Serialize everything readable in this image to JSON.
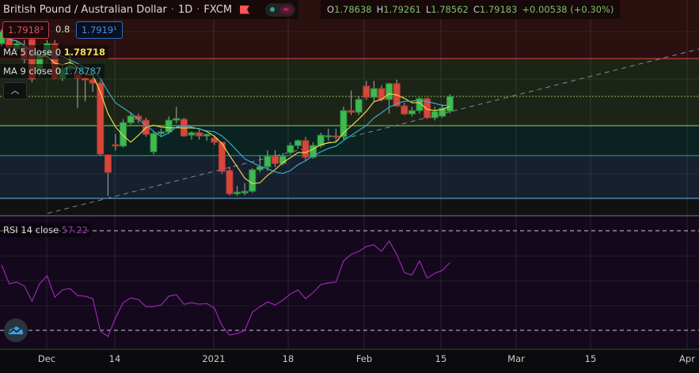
{
  "header": {
    "title": "British Pound / Australian Dollar",
    "interval": "1D",
    "exchange": "FXCM",
    "sep": "·"
  },
  "ohlc": {
    "o_label": "O",
    "o": "1.78638",
    "h_label": "H",
    "h": "1.79261",
    "l_label": "L",
    "l": "1.78562",
    "c_label": "C",
    "c": "1.79183",
    "change": "+0.00538 (+0.30%)"
  },
  "bid_ask": {
    "sell": "1.7918³",
    "spread": "0.8",
    "buy": "1.7919¹"
  },
  "legend": {
    "ma5_label": "MA 5 close 0",
    "ma5_value": "1.78718",
    "ma9_label": "MA 9 close 0",
    "ma9_value": "1.78787",
    "rsi_label": "RSI 14 close",
    "rsi_value": "57.22"
  },
  "collapse_icon": "chevron-up-icon",
  "colors": {
    "up": "#3fb950",
    "down": "#d9463c",
    "ma5": "#e6d84a",
    "ma9": "#39a9c9",
    "rsi": "#9c27b0"
  },
  "chart_data": [
    {
      "type": "candlestick",
      "title": "British Pound / Australian Dollar · 1D · FXCM",
      "x_ticks": [
        "Dec",
        "14",
        "2021",
        "18",
        "Feb",
        "15",
        "Mar",
        "15",
        "Apr"
      ],
      "levels": [
        1.8057,
        1.7811,
        1.7701,
        1.7544
      ],
      "current_price": 1.79183,
      "candles": [
        [
          1.8112,
          1.8165,
          1.81,
          1.8156
        ],
        [
          1.8142,
          1.815,
          1.8085,
          1.8098
        ],
        [
          1.8092,
          1.812,
          1.808,
          1.8112
        ],
        [
          1.8104,
          1.8125,
          1.804,
          1.8054
        ],
        [
          1.8127,
          1.8135,
          1.797,
          1.7982
        ],
        [
          1.8011,
          1.808,
          1.799,
          1.8069
        ],
        [
          1.8069,
          1.8125,
          1.806,
          1.8112
        ],
        [
          1.8112,
          1.8125,
          1.7982,
          1.7985
        ],
        [
          1.7985,
          1.803,
          1.7975,
          1.802
        ],
        [
          1.802,
          1.808,
          1.801,
          1.8031
        ],
        [
          1.7997,
          1.801,
          1.7875,
          1.7985
        ],
        [
          1.7985,
          1.799,
          1.79,
          1.7979
        ],
        [
          1.7979,
          1.799,
          1.7935,
          1.7967
        ],
        [
          1.7967,
          1.7975,
          1.77,
          1.7707
        ],
        [
          1.7704,
          1.7705,
          1.7553,
          1.764
        ],
        [
          1.7741,
          1.778,
          1.772,
          1.7736
        ],
        [
          1.7736,
          1.7835,
          1.773,
          1.7822
        ],
        [
          1.7822,
          1.786,
          1.7815,
          1.7846
        ],
        [
          1.7846,
          1.7855,
          1.782,
          1.7834
        ],
        [
          1.7831,
          1.784,
          1.777,
          1.7779
        ],
        [
          1.7715,
          1.779,
          1.7705,
          1.7782
        ],
        [
          1.7782,
          1.78,
          1.777,
          1.7788
        ],
        [
          1.7788,
          1.7845,
          1.778,
          1.7831
        ],
        [
          1.7831,
          1.788,
          1.782,
          1.7837
        ],
        [
          1.7834,
          1.784,
          1.777,
          1.7773
        ],
        [
          1.7776,
          1.779,
          1.776,
          1.7785
        ],
        [
          1.7785,
          1.7795,
          1.776,
          1.7773
        ],
        [
          1.7773,
          1.7782,
          1.7755,
          1.7779
        ],
        [
          1.7765,
          1.7775,
          1.774,
          1.775
        ],
        [
          1.775,
          1.7752,
          1.7635,
          1.7643
        ],
        [
          1.7646,
          1.766,
          1.7555,
          1.7561
        ],
        [
          1.7561,
          1.759,
          1.7553,
          1.7567
        ],
        [
          1.7564,
          1.76,
          1.7555,
          1.757
        ],
        [
          1.757,
          1.7655,
          1.7565,
          1.7649
        ],
        [
          1.7649,
          1.77,
          1.764,
          1.766
        ],
        [
          1.766,
          1.772,
          1.7645,
          1.7698
        ],
        [
          1.7698,
          1.772,
          1.766,
          1.7672
        ],
        [
          1.7672,
          1.771,
          1.7665,
          1.7698
        ],
        [
          1.7712,
          1.775,
          1.7705,
          1.7738
        ],
        [
          1.7738,
          1.776,
          1.7725,
          1.7756
        ],
        [
          1.7756,
          1.777,
          1.768,
          1.7695
        ],
        [
          1.7695,
          1.775,
          1.769,
          1.7738
        ],
        [
          1.7738,
          1.7785,
          1.773,
          1.7776
        ],
        [
          1.7772,
          1.78,
          1.7755,
          1.7774
        ],
        [
          1.7773,
          1.78,
          1.776,
          1.777
        ],
        [
          1.777,
          1.788,
          1.776,
          1.7866
        ],
        [
          1.7866,
          1.794,
          1.785,
          1.786
        ],
        [
          1.786,
          1.792,
          1.785,
          1.7907
        ],
        [
          1.7956,
          1.7975,
          1.7905,
          1.7915
        ],
        [
          1.7915,
          1.7975,
          1.79,
          1.7947
        ],
        [
          1.7947,
          1.796,
          1.79,
          1.7907
        ],
        [
          1.7907,
          1.7968,
          1.7855,
          1.7965
        ],
        [
          1.7965,
          1.798,
          1.788,
          1.7883
        ],
        [
          1.7883,
          1.7895,
          1.785,
          1.7854
        ],
        [
          1.7854,
          1.788,
          1.7845,
          1.7866
        ],
        [
          1.7866,
          1.7915,
          1.7855,
          1.791
        ],
        [
          1.791,
          1.7915,
          1.7835,
          1.784
        ],
        [
          1.784,
          1.788,
          1.783,
          1.7863
        ],
        [
          1.7846,
          1.789,
          1.784,
          1.7875
        ],
        [
          1.78638,
          1.79261,
          1.78562,
          1.79183
        ]
      ],
      "ma_periods": [
        5,
        9
      ]
    },
    {
      "type": "line",
      "title": "RSI 14 close",
      "ylim": [
        0,
        100
      ],
      "bands": [
        70,
        30
      ],
      "values": [
        56.3,
        48.7,
        49.4,
        47.8,
        41.7,
        48.7,
        51.9,
        43.3,
        46.2,
        46.8,
        44.0,
        43.7,
        42.7,
        29.7,
        27.5,
        35.1,
        41.1,
        43.0,
        42.4,
        39.5,
        39.5,
        40.2,
        43.7,
        44.3,
        40.5,
        41.1,
        40.5,
        40.8,
        38.9,
        31.9,
        28.1,
        28.7,
        30.0,
        37.3,
        39.5,
        41.4,
        40.2,
        42.1,
        44.6,
        46.2,
        42.7,
        45.2,
        48.4,
        49.0,
        49.4,
        57.9,
        60.5,
        61.7,
        63.7,
        64.3,
        61.7,
        65.9,
        60.5,
        53.2,
        52.2,
        57.9,
        51.0,
        52.9,
        54.1,
        57.22
      ]
    }
  ]
}
